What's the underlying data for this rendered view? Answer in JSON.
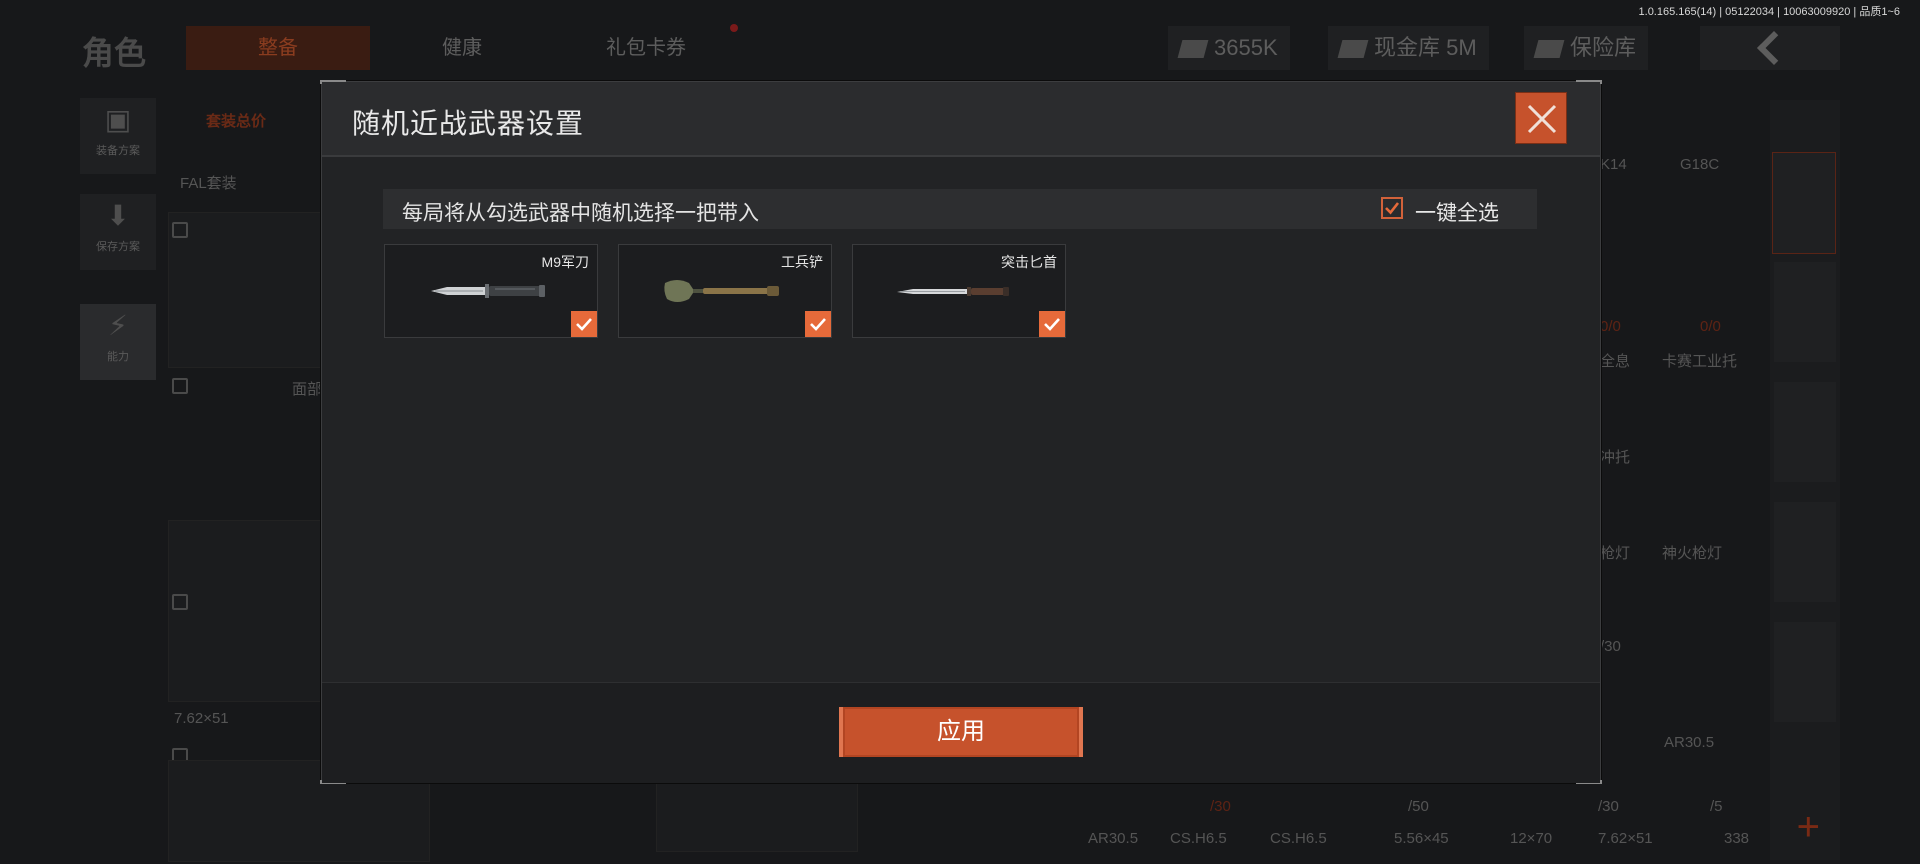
{
  "version_info": "1.0.165.165(14) | 05122034 | 10063009920 | 品质1~6",
  "background": {
    "title": "角色",
    "tabs": [
      {
        "label": "整备",
        "active": true
      },
      {
        "label": "健康",
        "active": false
      },
      {
        "label": "礼包卡券",
        "active": false
      }
    ],
    "resources": {
      "currency": "3655K",
      "cash_vault": "现金库 5M",
      "safe": "保险库"
    },
    "left_buttons": [
      "装备方案",
      "保存方案",
      "能力"
    ],
    "loadout_price_label": "套装总价",
    "loadout_name": "FAL套装",
    "slot_labels": [
      "面部",
      "7.62×51"
    ],
    "right_labels": [
      "K14",
      "G18C",
      "全息",
      "卡赛工业托",
      "冲托",
      "枪灯",
      "神火枪灯",
      "AR30.5"
    ],
    "ammo_counts": [
      "0/0",
      "0/0",
      "/30",
      "/30",
      "/50",
      "/30",
      "/5"
    ],
    "bottom_labels": [
      "AR30.5",
      "CS.H6.5",
      "CS.H6.5",
      "5.56×45",
      "12×70",
      "7.62×51",
      "338"
    ]
  },
  "modal": {
    "title": "随机近战武器设置",
    "info_text": "每局将从勾选武器中随机选择一把带入",
    "select_all_label": "一键全选",
    "select_all_checked": true,
    "weapons": [
      {
        "name": "M9军刀",
        "icon": "combat-knife-icon",
        "checked": true
      },
      {
        "name": "工兵铲",
        "icon": "shovel-icon",
        "checked": true
      },
      {
        "name": "突击匕首",
        "icon": "dagger-icon",
        "checked": true
      }
    ],
    "apply_label": "应用"
  },
  "colors": {
    "accent": "#c6522c",
    "checkbox": "#e66a3a",
    "modal_bg": "#222325",
    "text": "#e8e8e8"
  }
}
